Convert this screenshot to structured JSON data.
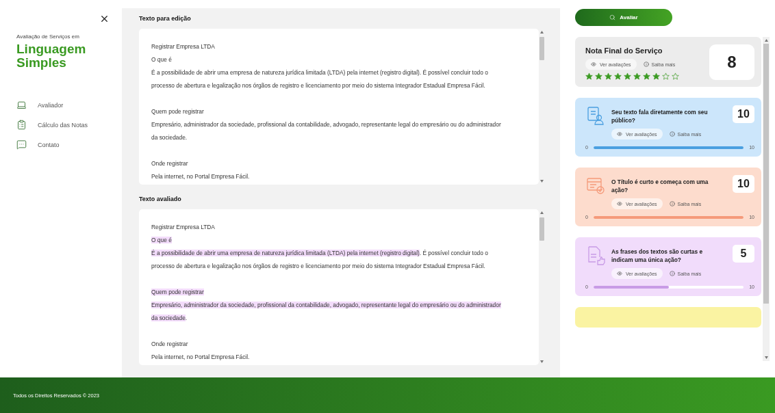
{
  "sidebar": {
    "subtitle": "Avaliação de Serviços em",
    "brand_lines": [
      "Linguagem",
      "Simples"
    ],
    "items": [
      {
        "kind": "laptop",
        "label": "Avaliador"
      },
      {
        "kind": "clipboard",
        "label": "Cálculo das Notas"
      },
      {
        "kind": "chat",
        "label": "Contato"
      }
    ]
  },
  "editor": {
    "title": "Texto para edição",
    "paragraphs": [
      [
        [
          {
            "text": "Registrar Empresa LTDA",
            "highlighted": false
          }
        ],
        [
          {
            "text": "O que é",
            "highlighted": false
          }
        ],
        [
          {
            "text": "É a possibilidade de abrir uma empresa de natureza jurídica limitada (LTDA) pela internet (registro digital). É possível concluir todo o",
            "highlighted": false
          }
        ],
        [
          {
            "text": "processo de abertura e legalização nos órgãos de registro e licenciamento por meio do sistema Integrador Estadual Empresa Fácil.",
            "highlighted": false
          }
        ]
      ],
      [
        [
          {
            "text": "Quem pode registrar",
            "highlighted": false
          }
        ],
        [
          {
            "text": "Empresário, administrador da sociedade, profissional da contabilidade, advogado, representante legal do empresário ou do administrador",
            "highlighted": false
          }
        ],
        [
          {
            "text": "da sociedade.",
            "highlighted": false
          }
        ]
      ],
      [
        [
          {
            "text": "Onde registrar",
            "highlighted": false
          }
        ],
        [
          {
            "text": "Pela internet, no Portal Empresa Fácil.",
            "highlighted": false
          }
        ]
      ]
    ]
  },
  "evaluated": {
    "title": "Texto avaliado",
    "paragraphs": [
      [
        [
          {
            "text": "Registrar Empresa LTDA",
            "highlighted": false
          }
        ],
        [
          {
            "text": "O que é",
            "highlighted": true
          }
        ],
        [
          {
            "text": "É a possibilidade de abrir uma empresa de natureza jurídica limitada (LTDA) pela internet (registro digital)",
            "highlighted": true
          },
          {
            "text": ". É possível concluir todo o",
            "highlighted": false
          }
        ],
        [
          {
            "text": "processo de abertura e legalização nos órgãos de registro e licenciamento por meio do sistema Integrador Estadual Empresa Fácil.",
            "highlighted": false
          }
        ]
      ],
      [
        [
          {
            "text": "Quem pode registrar",
            "highlighted": true
          }
        ],
        [
          {
            "text": "Empresário, administrador da sociedade, profissional da contabilidade, advogado, representante legal do empresário ou do administrador",
            "highlighted": true
          }
        ],
        [
          {
            "text": "da sociedade",
            "highlighted": true
          },
          {
            "text": ".",
            "highlighted": false
          }
        ]
      ],
      [
        [
          {
            "text": "Onde registrar",
            "highlighted": false
          }
        ],
        [
          {
            "text": "Pela internet, no Portal Empresa Fácil.",
            "highlighted": false
          }
        ]
      ]
    ]
  },
  "evaluate_button": "Avaliar",
  "final_score": {
    "title": "Nota Final do Serviço",
    "view_link": "Ver avaliações",
    "info_link": "Saiba mais",
    "stars": 8,
    "score": "8"
  },
  "criteria": [
    {
      "kind": "audience",
      "color": "#cce6fb",
      "title": "Seu texto fala diretamente com seu público?",
      "score": "10",
      "view_link": "Ver avaliações",
      "info_link": "Saiba mais",
      "min": "0",
      "max": "10",
      "level": 1
    },
    {
      "kind": "title",
      "color": "#fddccd",
      "title": "O Título é curto e começa com uma ação?",
      "score": "10",
      "view_link": "Ver avaliações",
      "info_link": "Saiba mais",
      "min": "0",
      "max": "10",
      "level": 1
    },
    {
      "kind": "sentences",
      "color": "#f1dcfb",
      "title": "As frases dos textos são curtas e indicam uma única ação?",
      "score": "5",
      "view_link": "Ver avaliações",
      "info_link": "Saiba mais",
      "min": "0",
      "max": "10",
      "level": 0.5
    },
    {
      "kind": "partial",
      "color": "#faf3a2"
    }
  ],
  "footer": "Todos os Direitos Reservados © 2023"
}
